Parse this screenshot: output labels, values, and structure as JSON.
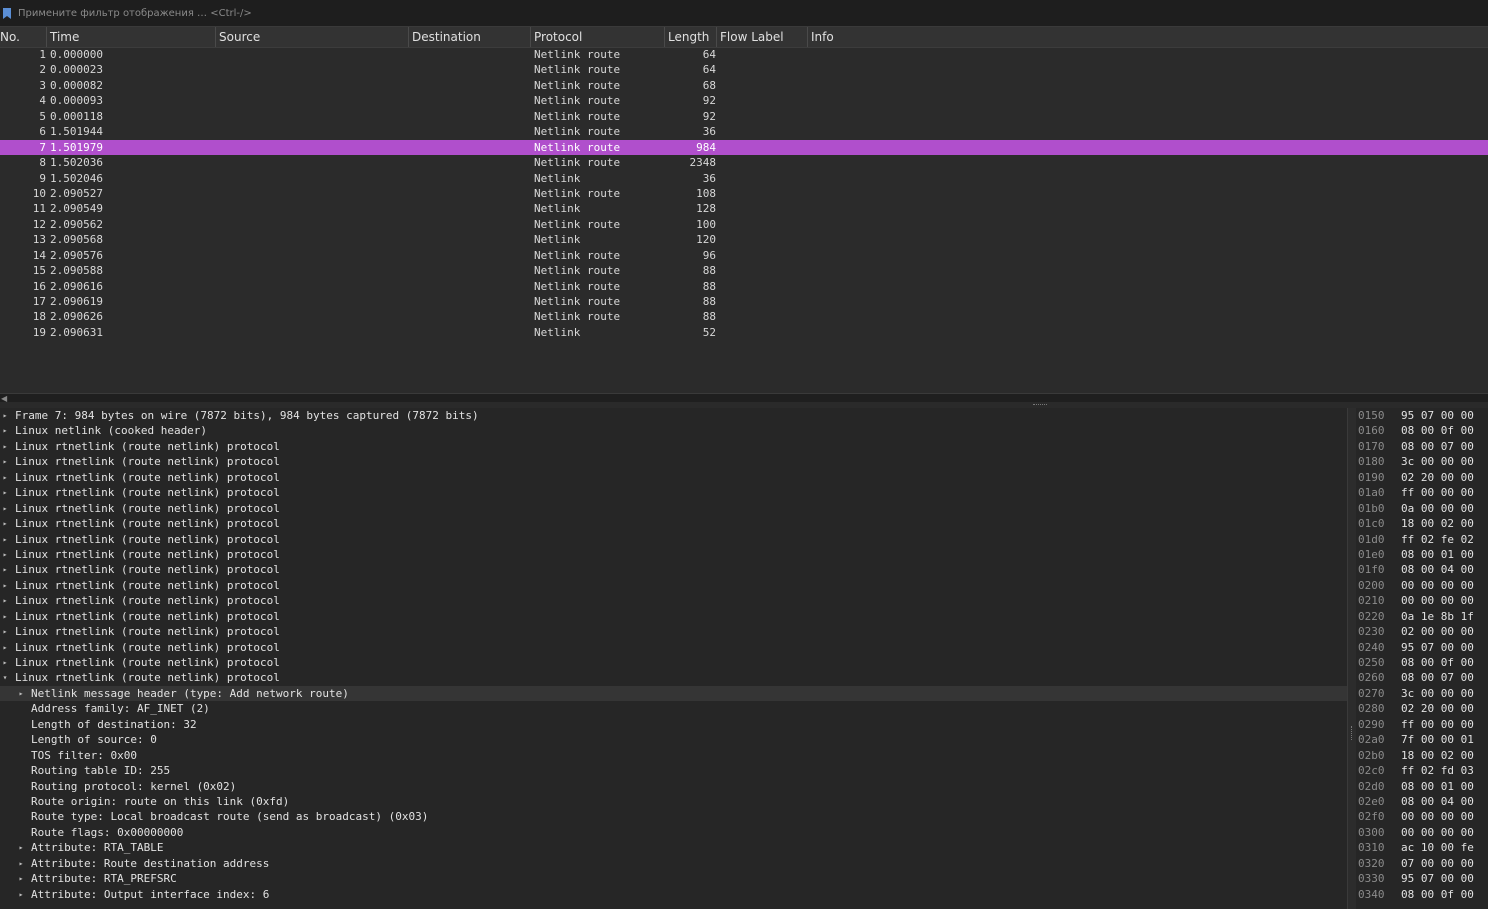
{
  "filter": {
    "placeholder": "Примените фильтр отображения … <Ctrl-/>"
  },
  "columns": [
    "No.",
    "Time",
    "Source",
    "Destination",
    "Protocol",
    "Length",
    "Flow Label",
    "Info"
  ],
  "packets": [
    {
      "no": "1",
      "time": "0.000000",
      "protocol": "Netlink route",
      "length": "64"
    },
    {
      "no": "2",
      "time": "0.000023",
      "protocol": "Netlink route",
      "length": "64"
    },
    {
      "no": "3",
      "time": "0.000082",
      "protocol": "Netlink route",
      "length": "68"
    },
    {
      "no": "4",
      "time": "0.000093",
      "protocol": "Netlink route",
      "length": "92"
    },
    {
      "no": "5",
      "time": "0.000118",
      "protocol": "Netlink route",
      "length": "92"
    },
    {
      "no": "6",
      "time": "1.501944",
      "protocol": "Netlink route",
      "length": "36"
    },
    {
      "no": "7",
      "time": "1.501979",
      "protocol": "Netlink route",
      "length": "984",
      "selected": true
    },
    {
      "no": "8",
      "time": "1.502036",
      "protocol": "Netlink route",
      "length": "2348"
    },
    {
      "no": "9",
      "time": "1.502046",
      "protocol": "Netlink",
      "length": "36"
    },
    {
      "no": "10",
      "time": "2.090527",
      "protocol": "Netlink route",
      "length": "108"
    },
    {
      "no": "11",
      "time": "2.090549",
      "protocol": "Netlink",
      "length": "128"
    },
    {
      "no": "12",
      "time": "2.090562",
      "protocol": "Netlink route",
      "length": "100"
    },
    {
      "no": "13",
      "time": "2.090568",
      "protocol": "Netlink",
      "length": "120"
    },
    {
      "no": "14",
      "time": "2.090576",
      "protocol": "Netlink route",
      "length": "96"
    },
    {
      "no": "15",
      "time": "2.090588",
      "protocol": "Netlink route",
      "length": "88"
    },
    {
      "no": "16",
      "time": "2.090616",
      "protocol": "Netlink route",
      "length": "88"
    },
    {
      "no": "17",
      "time": "2.090619",
      "protocol": "Netlink route",
      "length": "88"
    },
    {
      "no": "18",
      "time": "2.090626",
      "protocol": "Netlink route",
      "length": "88"
    },
    {
      "no": "19",
      "time": "2.090631",
      "protocol": "Netlink",
      "length": "52"
    }
  ],
  "details": [
    {
      "text": "Frame 7: 984 bytes on wire (7872 bits), 984 bytes captured (7872 bits)",
      "level": 0,
      "arrow": "collapsed"
    },
    {
      "text": "Linux netlink (cooked header)",
      "level": 0,
      "arrow": "collapsed"
    },
    {
      "text": "Linux rtnetlink (route netlink) protocol",
      "level": 0,
      "arrow": "collapsed"
    },
    {
      "text": "Linux rtnetlink (route netlink) protocol",
      "level": 0,
      "arrow": "collapsed"
    },
    {
      "text": "Linux rtnetlink (route netlink) protocol",
      "level": 0,
      "arrow": "collapsed"
    },
    {
      "text": "Linux rtnetlink (route netlink) protocol",
      "level": 0,
      "arrow": "collapsed"
    },
    {
      "text": "Linux rtnetlink (route netlink) protocol",
      "level": 0,
      "arrow": "collapsed"
    },
    {
      "text": "Linux rtnetlink (route netlink) protocol",
      "level": 0,
      "arrow": "collapsed"
    },
    {
      "text": "Linux rtnetlink (route netlink) protocol",
      "level": 0,
      "arrow": "collapsed"
    },
    {
      "text": "Linux rtnetlink (route netlink) protocol",
      "level": 0,
      "arrow": "collapsed"
    },
    {
      "text": "Linux rtnetlink (route netlink) protocol",
      "level": 0,
      "arrow": "collapsed"
    },
    {
      "text": "Linux rtnetlink (route netlink) protocol",
      "level": 0,
      "arrow": "collapsed"
    },
    {
      "text": "Linux rtnetlink (route netlink) protocol",
      "level": 0,
      "arrow": "collapsed"
    },
    {
      "text": "Linux rtnetlink (route netlink) protocol",
      "level": 0,
      "arrow": "collapsed"
    },
    {
      "text": "Linux rtnetlink (route netlink) protocol",
      "level": 0,
      "arrow": "collapsed"
    },
    {
      "text": "Linux rtnetlink (route netlink) protocol",
      "level": 0,
      "arrow": "collapsed"
    },
    {
      "text": "Linux rtnetlink (route netlink) protocol",
      "level": 0,
      "arrow": "collapsed"
    },
    {
      "text": "Linux rtnetlink (route netlink) protocol",
      "level": 0,
      "arrow": "expanded"
    },
    {
      "text": "Netlink message header (type: Add network route)",
      "level": 1,
      "arrow": "collapsed",
      "highlight": true
    },
    {
      "text": "Address family: AF_INET (2)",
      "level": 1,
      "arrow": "none"
    },
    {
      "text": "Length of destination: 32",
      "level": 1,
      "arrow": "none"
    },
    {
      "text": "Length of source: 0",
      "level": 1,
      "arrow": "none"
    },
    {
      "text": "TOS filter: 0x00",
      "level": 1,
      "arrow": "none"
    },
    {
      "text": "Routing table ID: 255",
      "level": 1,
      "arrow": "none"
    },
    {
      "text": "Routing protocol: kernel (0x02)",
      "level": 1,
      "arrow": "none"
    },
    {
      "text": "Route origin: route on this link (0xfd)",
      "level": 1,
      "arrow": "none"
    },
    {
      "text": "Route type: Local broadcast route (send as broadcast) (0x03)",
      "level": 1,
      "arrow": "none"
    },
    {
      "text": "Route flags: 0x00000000",
      "level": 1,
      "arrow": "none"
    },
    {
      "text": "Attribute: RTA_TABLE",
      "level": 1,
      "arrow": "collapsed"
    },
    {
      "text": "Attribute: Route destination address",
      "level": 1,
      "arrow": "collapsed"
    },
    {
      "text": "Attribute: RTA_PREFSRC",
      "level": 1,
      "arrow": "collapsed"
    },
    {
      "text": "Attribute: Output interface index: 6",
      "level": 1,
      "arrow": "collapsed"
    }
  ],
  "hex": [
    {
      "offset": "0150",
      "bytes": "95 07 00 00"
    },
    {
      "offset": "0160",
      "bytes": "08 00 0f 00"
    },
    {
      "offset": "0170",
      "bytes": "08 00 07 00"
    },
    {
      "offset": "0180",
      "bytes": "3c 00 00 00"
    },
    {
      "offset": "0190",
      "bytes": "02 20 00 00"
    },
    {
      "offset": "01a0",
      "bytes": "ff 00 00 00"
    },
    {
      "offset": "01b0",
      "bytes": "0a 00 00 00"
    },
    {
      "offset": "01c0",
      "bytes": "18 00 02 00"
    },
    {
      "offset": "01d0",
      "bytes": "ff 02 fe 02"
    },
    {
      "offset": "01e0",
      "bytes": "08 00 01 00"
    },
    {
      "offset": "01f0",
      "bytes": "08 00 04 00"
    },
    {
      "offset": "0200",
      "bytes": "00 00 00 00"
    },
    {
      "offset": "0210",
      "bytes": "00 00 00 00"
    },
    {
      "offset": "0220",
      "bytes": "0a 1e 8b 1f"
    },
    {
      "offset": "0230",
      "bytes": "02 00 00 00"
    },
    {
      "offset": "0240",
      "bytes": "95 07 00 00"
    },
    {
      "offset": "0250",
      "bytes": "08 00 0f 00"
    },
    {
      "offset": "0260",
      "bytes": "08 00 07 00"
    },
    {
      "offset": "0270",
      "bytes": "3c 00 00 00"
    },
    {
      "offset": "0280",
      "bytes": "02 20 00 00"
    },
    {
      "offset": "0290",
      "bytes": "ff 00 00 00"
    },
    {
      "offset": "02a0",
      "bytes": "7f 00 00 01"
    },
    {
      "offset": "02b0",
      "bytes": "18 00 02 00"
    },
    {
      "offset": "02c0",
      "bytes": "ff 02 fd 03"
    },
    {
      "offset": "02d0",
      "bytes": "08 00 01 00"
    },
    {
      "offset": "02e0",
      "bytes": "08 00 04 00"
    },
    {
      "offset": "02f0",
      "bytes": "00 00 00 00"
    },
    {
      "offset": "0300",
      "bytes": "00 00 00 00"
    },
    {
      "offset": "0310",
      "bytes": "ac 10 00 fe"
    },
    {
      "offset": "0320",
      "bytes": "07 00 00 00"
    },
    {
      "offset": "0330",
      "bytes": "95 07 00 00"
    },
    {
      "offset": "0340",
      "bytes": "08 00 0f 00"
    }
  ],
  "colors": {
    "selected_row": "#b04fcc",
    "background": "#252526",
    "header": "#333333"
  },
  "icons": {
    "filter_bookmark": "bookmark-icon",
    "tree_collapsed": "caret-right-icon",
    "tree_expanded": "caret-down-icon"
  }
}
